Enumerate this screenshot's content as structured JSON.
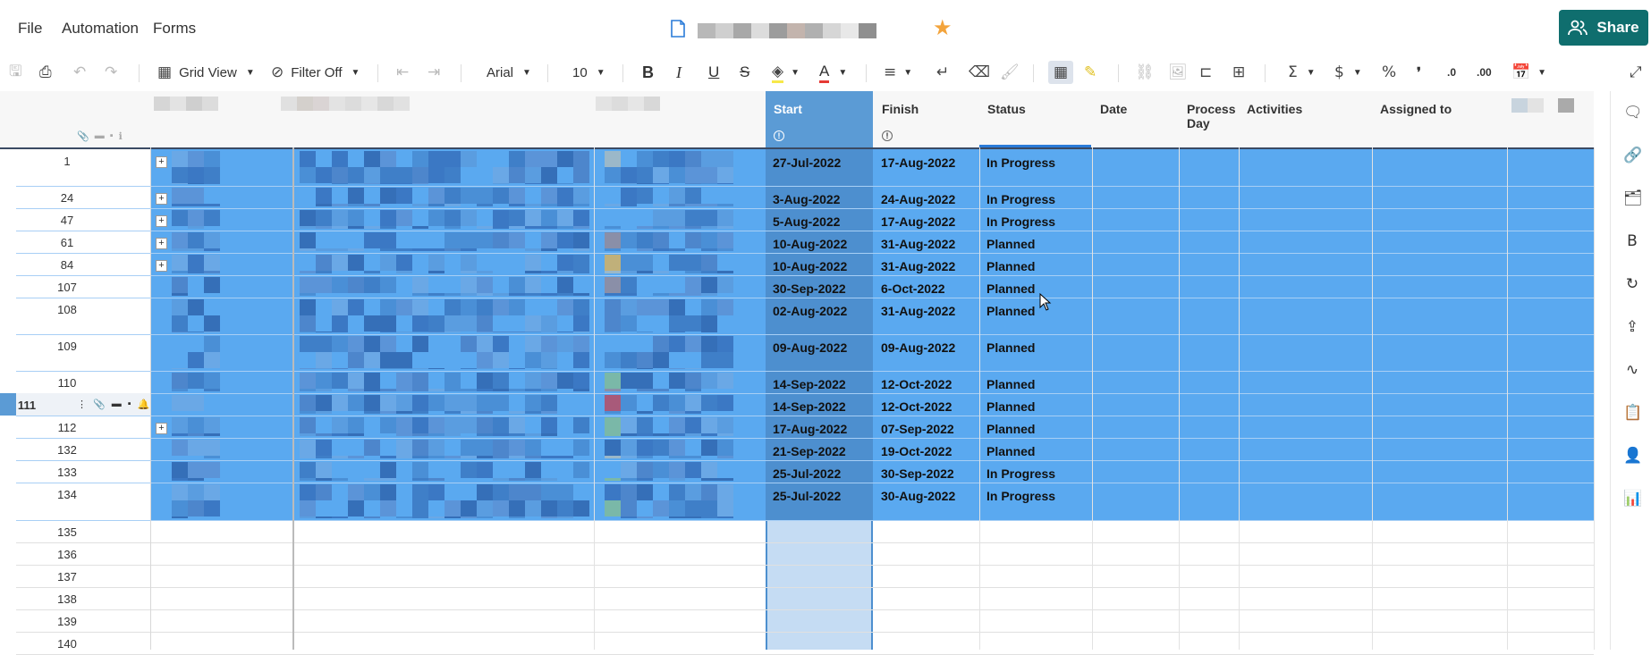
{
  "menu": {
    "file": "File",
    "automation": "Automation",
    "forms": "Forms"
  },
  "share_label": "Share",
  "toolbar": {
    "grid_view": "Grid View",
    "filter": "Filter Off",
    "font": "Arial",
    "font_size": "10"
  },
  "columns": {
    "start": "Start",
    "finish": "Finish",
    "status": "Status",
    "date": "Date",
    "process_day": "Process Day",
    "activities": "Activities",
    "assigned_to": "Assigned to"
  },
  "active_row": "111",
  "rows": [
    {
      "num": "1",
      "start": "27-Jul-2022",
      "finish": "17-Aug-2022",
      "status": "In Progress"
    },
    {
      "num": "24",
      "start": "3-Aug-2022",
      "finish": "24-Aug-2022",
      "status": "In Progress"
    },
    {
      "num": "47",
      "start": "5-Aug-2022",
      "finish": "17-Aug-2022",
      "status": "In Progress"
    },
    {
      "num": "61",
      "start": "10-Aug-2022",
      "finish": "31-Aug-2022",
      "status": "Planned"
    },
    {
      "num": "84",
      "start": "10-Aug-2022",
      "finish": "31-Aug-2022",
      "status": "Planned"
    },
    {
      "num": "107",
      "start": "30-Sep-2022",
      "finish": "6-Oct-2022",
      "status": "Planned"
    },
    {
      "num": "108",
      "start": "02-Aug-2022",
      "finish": "31-Aug-2022",
      "status": "Planned"
    },
    {
      "num": "109",
      "start": "09-Aug-2022",
      "finish": "09-Aug-2022",
      "status": "Planned"
    },
    {
      "num": "110",
      "start": "14-Sep-2022",
      "finish": "12-Oct-2022",
      "status": "Planned"
    },
    {
      "num": "111",
      "start": "14-Sep-2022",
      "finish": "12-Oct-2022",
      "status": "Planned"
    },
    {
      "num": "112",
      "start": "17-Aug-2022",
      "finish": "07-Sep-2022",
      "status": "Planned"
    },
    {
      "num": "132",
      "start": "21-Sep-2022",
      "finish": "19-Oct-2022",
      "status": "Planned"
    },
    {
      "num": "133",
      "start": "25-Jul-2022",
      "finish": "30-Sep-2022",
      "status": "In Progress"
    },
    {
      "num": "134",
      "start": "25-Jul-2022",
      "finish": "30-Aug-2022",
      "status": "In Progress"
    }
  ],
  "empty_rows": [
    "135",
    "136",
    "137",
    "138",
    "139",
    "140"
  ],
  "colors": {
    "selection": "#5aa9f0",
    "selected_header": "#5b9bd5",
    "share_bg": "#0f6e6e",
    "star": "#f3a43c"
  }
}
